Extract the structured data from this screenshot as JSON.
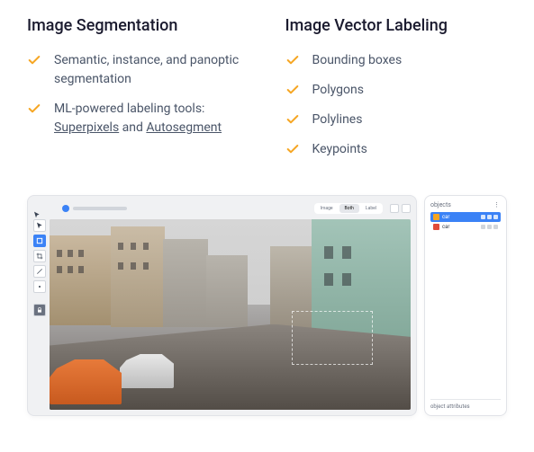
{
  "columns": {
    "left": {
      "heading": "Image Segmentation",
      "items": [
        {
          "pre": "Semantic, instance, and panoptic segmentation"
        },
        {
          "pre": "ML-powered labeling tools: ",
          "link1": "Superpixels",
          "mid": " and ",
          "link2": "Autosegment"
        }
      ]
    },
    "right": {
      "heading": "Image Vector Labeling",
      "items": [
        {
          "pre": "Bounding boxes"
        },
        {
          "pre": "Polygons"
        },
        {
          "pre": "Polylines"
        },
        {
          "pre": "Keypoints"
        }
      ]
    }
  },
  "editor": {
    "tabs": {
      "a": "Image",
      "b": "Both",
      "c": "Label"
    },
    "sidebar": {
      "title": "objects",
      "items": [
        {
          "label": "car",
          "color": "#f6a623",
          "selected": true
        },
        {
          "label": "car",
          "color": "#e04b3a",
          "selected": false
        }
      ],
      "bottom": "object attributes"
    }
  }
}
